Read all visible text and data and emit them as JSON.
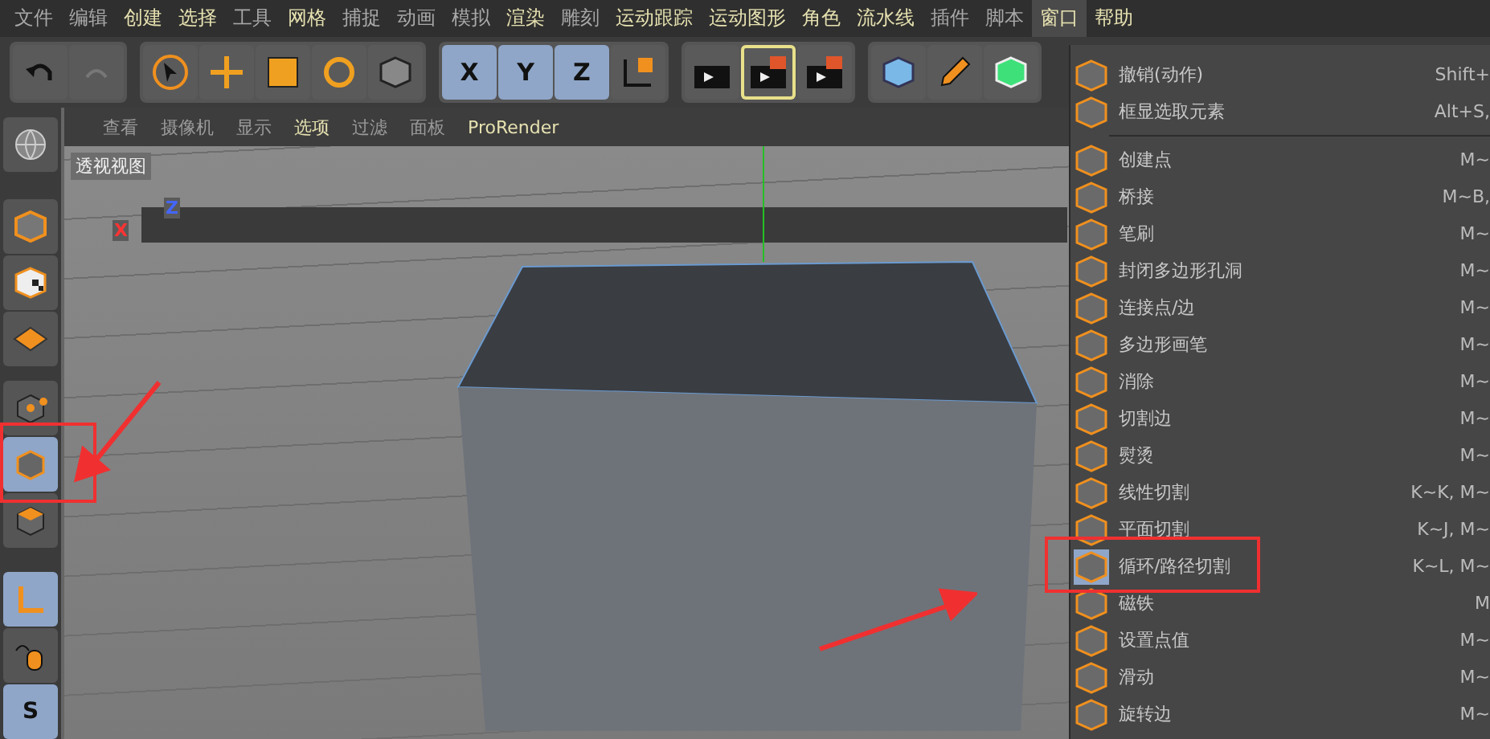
{
  "menubar": [
    {
      "label": "文件",
      "bright": false,
      "selected": false
    },
    {
      "label": "编辑",
      "bright": false,
      "selected": false
    },
    {
      "label": "创建",
      "bright": true,
      "selected": false
    },
    {
      "label": "选择",
      "bright": true,
      "selected": false
    },
    {
      "label": "工具",
      "bright": false,
      "selected": false
    },
    {
      "label": "网格",
      "bright": true,
      "selected": false
    },
    {
      "label": "捕捉",
      "bright": false,
      "selected": false
    },
    {
      "label": "动画",
      "bright": false,
      "selected": false
    },
    {
      "label": "模拟",
      "bright": false,
      "selected": false
    },
    {
      "label": "渲染",
      "bright": true,
      "selected": false
    },
    {
      "label": "雕刻",
      "bright": false,
      "selected": false
    },
    {
      "label": "运动跟踪",
      "bright": true,
      "selected": false
    },
    {
      "label": "运动图形",
      "bright": true,
      "selected": false
    },
    {
      "label": "角色",
      "bright": true,
      "selected": false
    },
    {
      "label": "流水线",
      "bright": true,
      "selected": false
    },
    {
      "label": "插件",
      "bright": false,
      "selected": false
    },
    {
      "label": "脚本",
      "bright": false,
      "selected": false
    },
    {
      "label": "窗口",
      "bright": true,
      "selected": true
    },
    {
      "label": "帮助",
      "bright": true,
      "selected": false
    }
  ],
  "toolbar": {
    "axes": [
      {
        "label": "X",
        "selected": true
      },
      {
        "label": "Y",
        "selected": true
      },
      {
        "label": "Z",
        "selected": true
      }
    ]
  },
  "left_tools": [
    {
      "kind": "globe",
      "selected": false
    },
    {
      "kind": "cube",
      "selected": false
    },
    {
      "kind": "checker",
      "selected": false
    },
    {
      "kind": "grid",
      "selected": false
    },
    {
      "kind": "points",
      "selected": false
    },
    {
      "kind": "edges",
      "selected": true
    },
    {
      "kind": "polygons",
      "selected": false
    },
    {
      "kind": "axis",
      "selected": true
    },
    {
      "kind": "mouse",
      "selected": false
    },
    {
      "kind": "snap",
      "label": "S",
      "selected": true
    }
  ],
  "viewport": {
    "menu": [
      {
        "label": "查看",
        "bright": false
      },
      {
        "label": "摄像机",
        "bright": false
      },
      {
        "label": "显示",
        "bright": false
      },
      {
        "label": "选项",
        "bright": true
      },
      {
        "label": "过滤",
        "bright": false
      },
      {
        "label": "面板",
        "bright": false
      },
      {
        "label": "ProRender",
        "bright": true
      }
    ],
    "label": "透视视图",
    "axis_labels": [
      "Z",
      "X"
    ]
  },
  "context_menu": {
    "groups": [
      [
        {
          "label": "撤销(动作)",
          "shortcut": "Shift+",
          "selected": false
        },
        {
          "label": "框显选取元素",
          "shortcut": "Alt+S,",
          "selected": false
        }
      ],
      [
        {
          "label": "创建点",
          "shortcut": "M~",
          "selected": false
        },
        {
          "label": "桥接",
          "shortcut": "M~B,",
          "selected": false
        },
        {
          "label": "笔刷",
          "shortcut": "M~",
          "selected": false
        },
        {
          "label": "封闭多边形孔洞",
          "shortcut": "M~",
          "selected": false
        },
        {
          "label": "连接点/边",
          "shortcut": "M~",
          "selected": false
        },
        {
          "label": "多边形画笔",
          "shortcut": "M~",
          "selected": false
        },
        {
          "label": "消除",
          "shortcut": "M~",
          "selected": false
        },
        {
          "label": "切割边",
          "shortcut": "M~",
          "selected": false
        },
        {
          "label": "熨烫",
          "shortcut": "M~",
          "selected": false
        },
        {
          "label": "线性切割",
          "shortcut": "K~K, M~",
          "selected": false
        },
        {
          "label": "平面切割",
          "shortcut": "K~J, M~",
          "selected": false
        },
        {
          "label": "循环/路径切割",
          "shortcut": "K~L, M~",
          "selected": true
        },
        {
          "label": "磁铁",
          "shortcut": "M",
          "selected": false
        },
        {
          "label": "设置点值",
          "shortcut": "M~",
          "selected": false
        },
        {
          "label": "滑动",
          "shortcut": "M~",
          "selected": false
        },
        {
          "label": "旋转边",
          "shortcut": "M~",
          "selected": false
        }
      ]
    ]
  }
}
